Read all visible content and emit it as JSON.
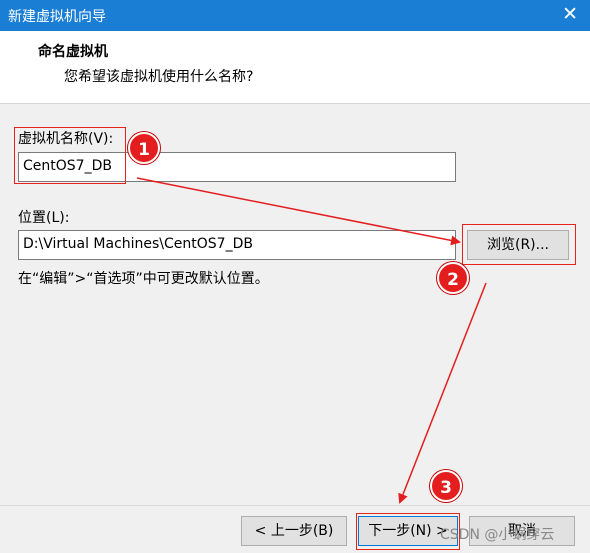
{
  "window": {
    "title": "新建虚拟机向导",
    "close_glyph": "✕"
  },
  "header": {
    "title": "命名虚拟机",
    "subtitle": "您希望该虚拟机使用什么名称?"
  },
  "name_field": {
    "label": "虚拟机名称(V):",
    "value": "CentOS7_DB"
  },
  "location_field": {
    "label": "位置(L):",
    "value": "D:\\Virtual Machines\\CentOS7_DB"
  },
  "browse_button": {
    "label": "浏览(R)..."
  },
  "hint": "在“编辑”>“首选项”中可更改默认位置。",
  "footer": {
    "back_label": "< 上一步(B)",
    "next_label": "下一步(N) >",
    "cancel_label": "取消"
  },
  "annotations": {
    "step1": "1",
    "step2": "2",
    "step3": "3",
    "color": "#e41e1e"
  },
  "watermark": "CSDN @小蜗穿云"
}
